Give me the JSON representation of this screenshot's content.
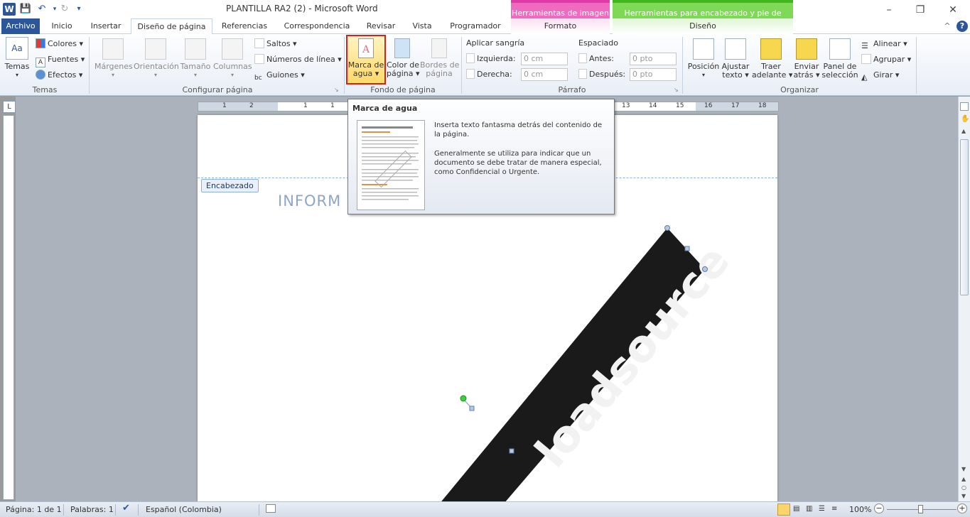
{
  "titlebar": {
    "app_icon": "W",
    "doc_title": "PLANTILLA RA2 (2)  -  Microsoft Word",
    "context_image_tools": "Herramientas de imagen",
    "context_header_tools": "Herramientas para encabezado y pie de página",
    "quick_access": {
      "save_icon": "floppy-icon",
      "undo_icon": "undo-icon",
      "redo_icon": "redo-icon",
      "customize_icon": "dropdown-icon"
    },
    "window": {
      "minimize": "–",
      "restore": "❐",
      "close": "✕"
    }
  },
  "tabs": {
    "file": "Archivo",
    "home": "Inicio",
    "insert": "Insertar",
    "page_layout": "Diseño de página",
    "references": "Referencias",
    "mailings": "Correspondencia",
    "review": "Revisar",
    "view": "Vista",
    "developer": "Programador",
    "format": "Formato",
    "design": "Diseño",
    "collapse": "^",
    "help": "?"
  },
  "ribbon": {
    "themes": {
      "group": "Temas",
      "themes_btn": "Temas",
      "colors": "Colores",
      "fonts": "Fuentes",
      "effects": "Efectos"
    },
    "page_setup": {
      "group": "Configurar página",
      "margins": "Márgenes",
      "orientation": "Orientación",
      "size": "Tamaño",
      "columns": "Columnas",
      "breaks": "Saltos",
      "line_numbers": "Números de línea",
      "hyphenation": "Guiones"
    },
    "page_background": {
      "group": "Fondo de página",
      "watermark_l1": "Marca de",
      "watermark_l2": "agua",
      "page_color_l1": "Color de",
      "page_color_l2": "página",
      "page_borders_l1": "Bordes de",
      "page_borders_l2": "página"
    },
    "paragraph": {
      "group": "Párrafo",
      "indent_header": "Aplicar sangría",
      "left_label": "Izquierda:",
      "left_value": "0 cm",
      "right_label": "Derecha:",
      "right_value": "0 cm",
      "spacing_header": "Espaciado",
      "before_label": "Antes:",
      "before_value": "0 pto",
      "after_label": "Después:",
      "after_value": "0 pto"
    },
    "arrange": {
      "group": "Organizar",
      "position": "Posición",
      "wrap_l1": "Ajustar",
      "wrap_l2": "texto",
      "bring_l1": "Traer",
      "bring_l2": "adelante",
      "send_l1": "Enviar",
      "send_l2": "atrás",
      "panel_l1": "Panel de",
      "panel_l2": "selección",
      "align": "Alinear",
      "group_btn": "Agrupar",
      "rotate": "Girar"
    }
  },
  "tooltip": {
    "title": "Marca de agua",
    "p1": "Inserta texto fantasma detrás del contenido de la página.",
    "p2": "Generalmente se utiliza para indicar que un documento se debe tratar de manera especial, como Confidencial o Urgente."
  },
  "ruler": {
    "corner": "L",
    "ticks": [
      "1",
      "2",
      "1",
      "1",
      "2",
      "13",
      "14",
      "15",
      "16",
      "17",
      "18"
    ]
  },
  "document": {
    "header_tag": "Encabezado",
    "heading_fragment": "INFORM",
    "watermark_text": "loadsource"
  },
  "status": {
    "page": "Página: 1 de 1",
    "words": "Palabras: 1",
    "language": "Español (Colombia)",
    "zoom": "100%",
    "zoom_minus": "−",
    "zoom_plus": "+"
  },
  "colors": {
    "brand": "#2b579a",
    "image_tools": "#f06bc0",
    "header_tools": "#7ed957",
    "highlight_border": "#d61f1f",
    "watermark_band": "#1a1a1a"
  }
}
